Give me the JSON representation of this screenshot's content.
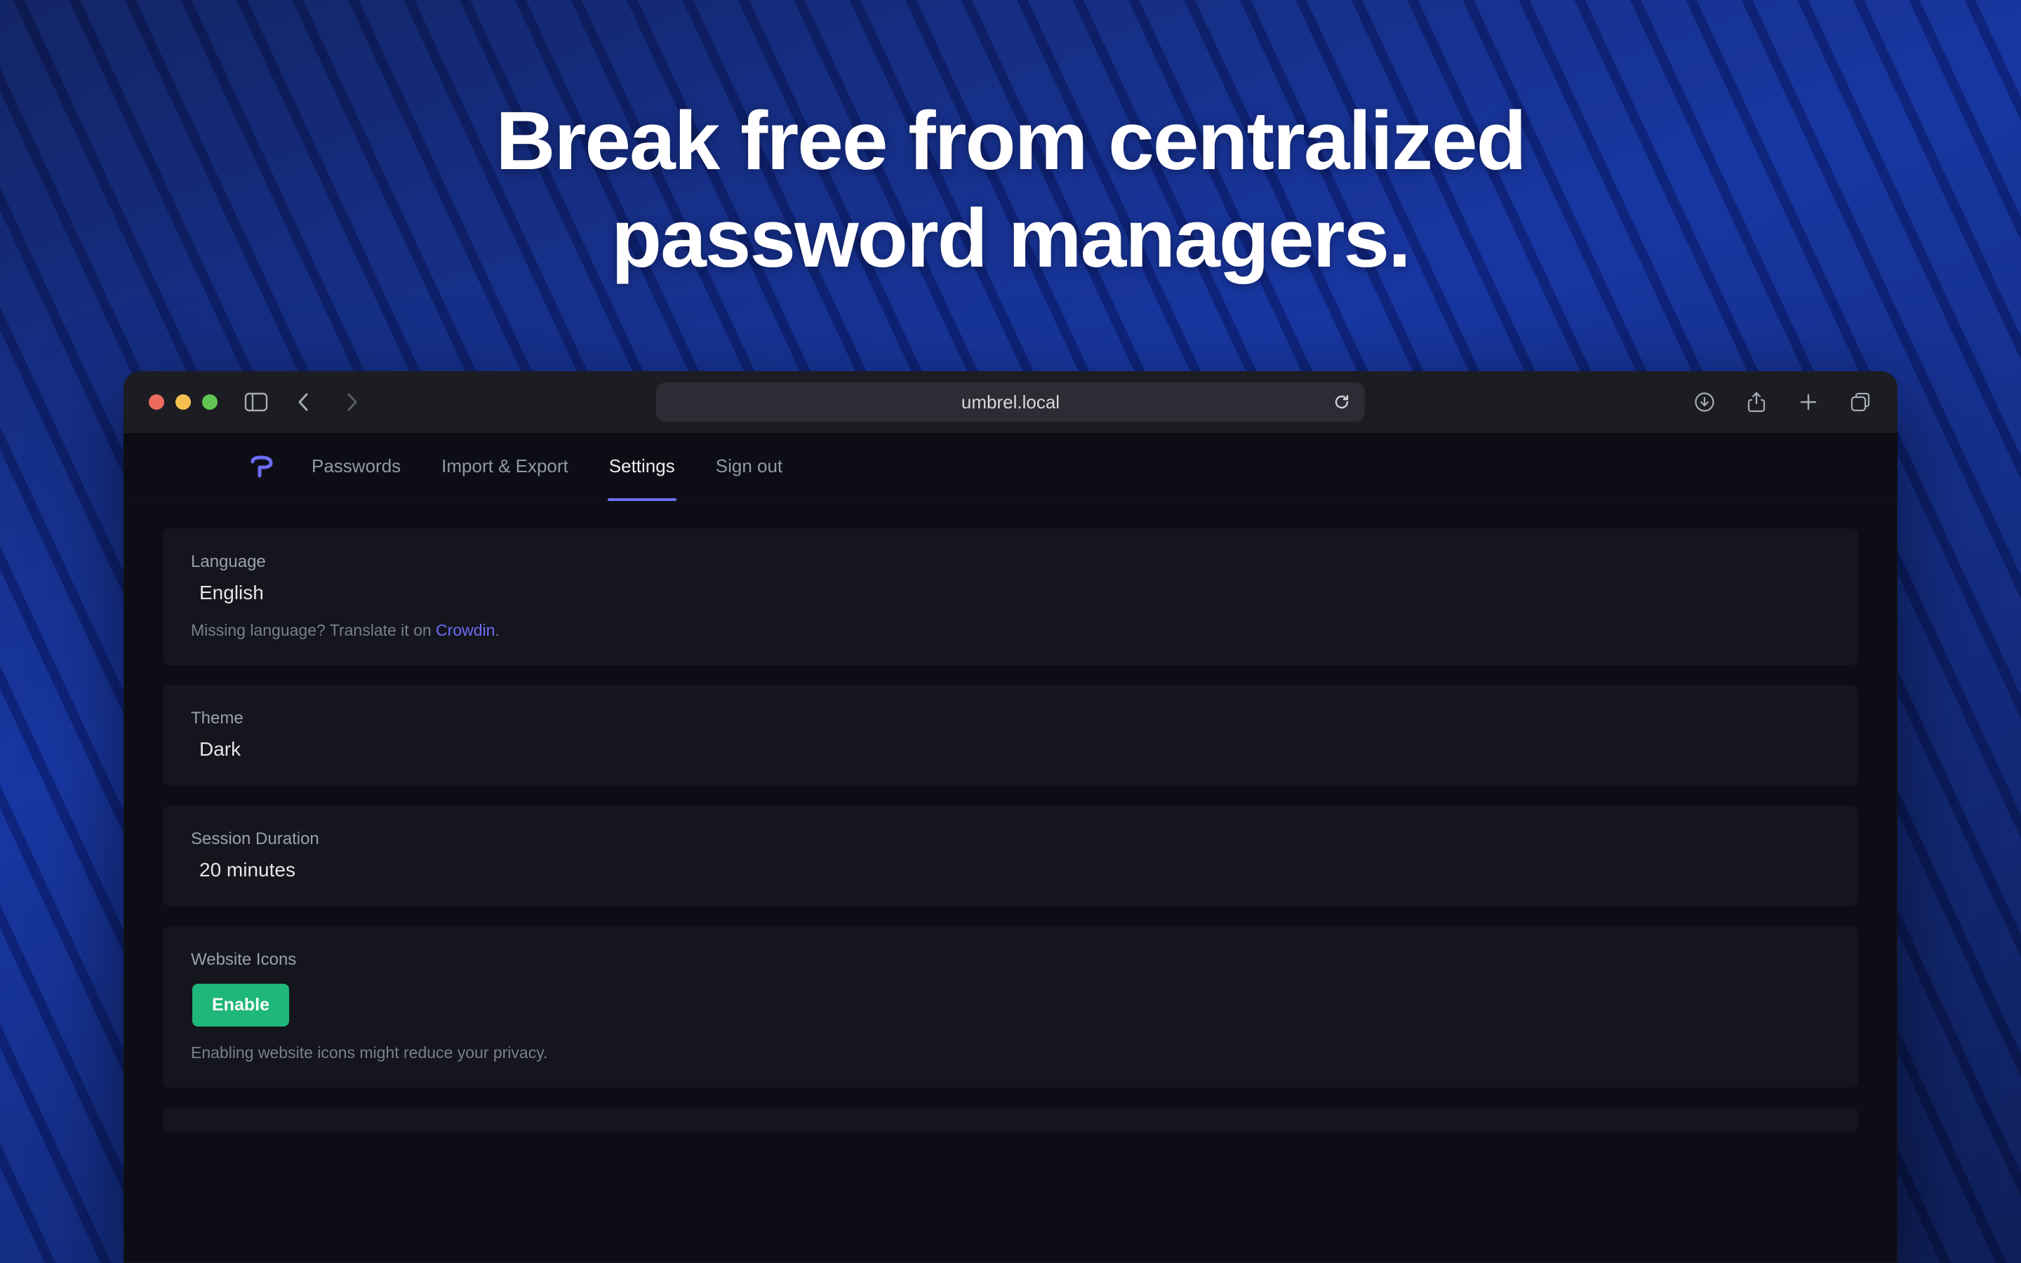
{
  "hero": {
    "line1": "Break free from centralized",
    "line2": "password managers."
  },
  "browser": {
    "url": "umbrel.local"
  },
  "nav": {
    "items": [
      {
        "label": "Passwords",
        "active": false
      },
      {
        "label": "Import & Export",
        "active": false
      },
      {
        "label": "Settings",
        "active": true
      },
      {
        "label": "Sign out",
        "active": false
      }
    ]
  },
  "settings": {
    "language": {
      "label": "Language",
      "value": "English",
      "note_prefix": "Missing language? Translate it on ",
      "note_link_text": "Crowdin",
      "note_suffix": "."
    },
    "theme": {
      "label": "Theme",
      "value": "Dark"
    },
    "session": {
      "label": "Session Duration",
      "value": "20 minutes"
    },
    "icons": {
      "label": "Website Icons",
      "button": "Enable",
      "note": "Enabling website icons might reduce your privacy."
    }
  }
}
